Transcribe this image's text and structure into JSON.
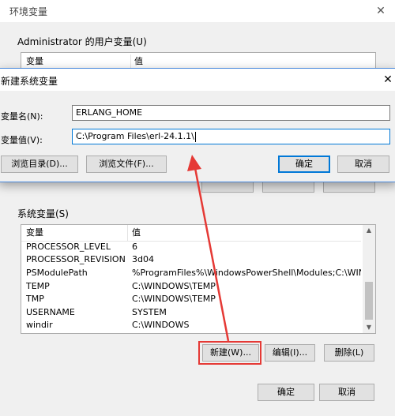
{
  "env_dialog": {
    "title": "环境变量",
    "close_icon": "close-icon",
    "user_group_label": "Administrator 的用户变量(U)",
    "user_columns": {
      "var": "变量",
      "val": "值"
    },
    "system_group_label": "系统变量(S)",
    "system_columns": {
      "var": "变量",
      "val": "值"
    },
    "system_rows": [
      {
        "name": "PROCESSOR_LEVEL",
        "value": "6"
      },
      {
        "name": "PROCESSOR_REVISION",
        "value": "3d04"
      },
      {
        "name": "PSModulePath",
        "value": "%ProgramFiles%\\WindowsPowerShell\\Modules;C:\\WINDOW..."
      },
      {
        "name": "TEMP",
        "value": "C:\\WINDOWS\\TEMP"
      },
      {
        "name": "TMP",
        "value": "C:\\WINDOWS\\TEMP"
      },
      {
        "name": "USERNAME",
        "value": "SYSTEM"
      },
      {
        "name": "windir",
        "value": "C:\\WINDOWS"
      }
    ],
    "system_buttons": {
      "new": "新建(W)...",
      "edit": "编辑(I)...",
      "delete": "删除(L)"
    },
    "ok": "确定",
    "cancel": "取消"
  },
  "new_dialog": {
    "title": "新建系统变量",
    "close_icon": "close-icon",
    "name_label": "变量名(N):",
    "value_label": "变量值(V):",
    "name_value": "ERLANG_HOME",
    "value_value": "C:\\Program Files\\erl-24.1.1\\",
    "browse_dir": "浏览目录(D)...",
    "browse_file": "浏览文件(F)...",
    "ok": "确定",
    "cancel": "取消"
  },
  "colors": {
    "accent": "#0078d7",
    "annotation": "#e53935"
  }
}
